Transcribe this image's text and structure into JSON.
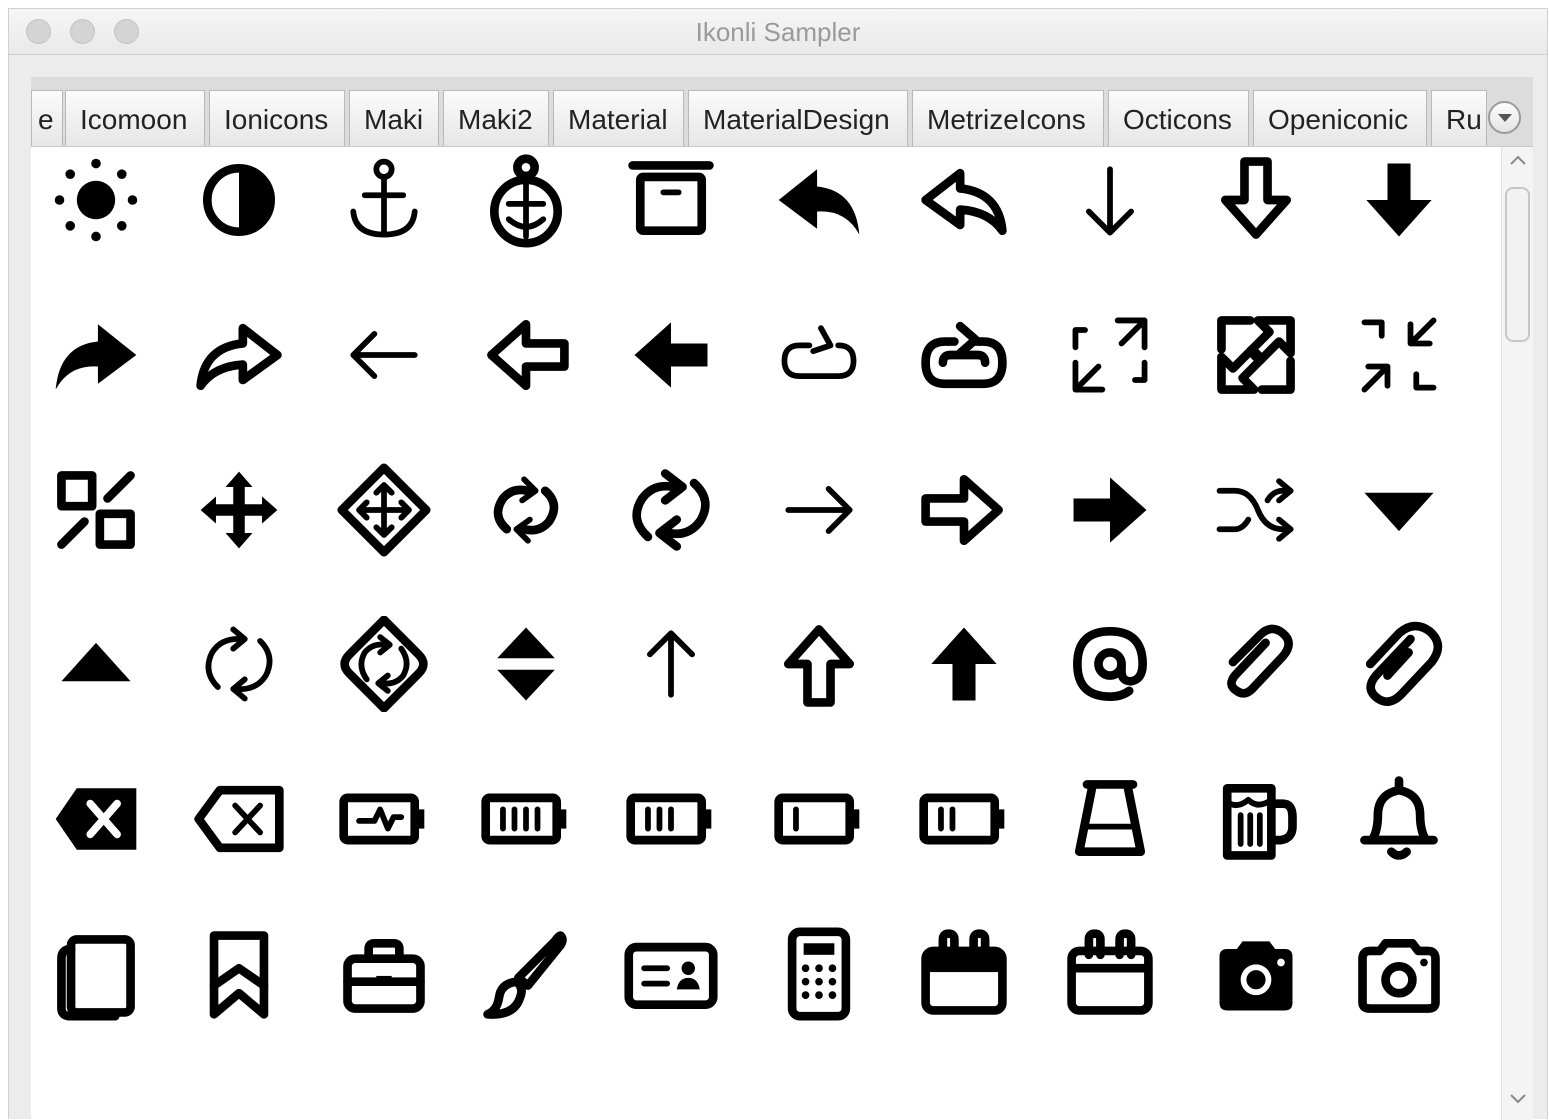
{
  "window": {
    "title": "Ikonli Sampler"
  },
  "tabs": [
    {
      "label": "e"
    },
    {
      "label": "Icomoon"
    },
    {
      "label": "Ionicons"
    },
    {
      "label": "Maki"
    },
    {
      "label": "Maki2"
    },
    {
      "label": "Material"
    },
    {
      "label": "MaterialDesign"
    },
    {
      "label": "MetrizeIcons"
    },
    {
      "label": "Octicons"
    },
    {
      "label": "Openiconic"
    },
    {
      "label": "Ru"
    }
  ],
  "icon_rows": [
    [
      "brightness-icon",
      "contrast-icon",
      "anchor-icon",
      "anchor-circle-icon",
      "archive-icon",
      "reply-filled-icon",
      "reply-outline-icon",
      "arrow-down-thin-icon",
      "arrow-down-outline-icon",
      "arrow-down-filled-icon"
    ],
    [
      "forward-filled-icon",
      "forward-outline-icon",
      "arrow-left-thin-icon",
      "arrow-left-outline-icon",
      "arrow-left-filled-icon",
      "loop-icon",
      "loop-outline-icon",
      "expand-icon",
      "expand-outline-icon",
      "minimize-icon"
    ],
    [
      "minimize-outline-icon",
      "move-icon",
      "move-outline-icon",
      "repeat-icon",
      "repeat-outline-icon",
      "arrow-right-thin-icon",
      "arrow-right-outline-icon",
      "arrow-right-filled-icon",
      "shuffle-icon",
      "caret-down-icon"
    ],
    [
      "caret-up-icon",
      "sync-icon",
      "sync-outline-icon",
      "unsorted-icon",
      "arrow-up-thin-icon",
      "arrow-up-outline-icon",
      "arrow-up-filled-icon",
      "at-icon",
      "attachment-icon",
      "attachment-outline-icon"
    ],
    [
      "backspace-filled-icon",
      "backspace-outline-icon",
      "battery-charge-icon",
      "battery-full-icon",
      "battery-high-icon",
      "battery-low-icon",
      "battery-mid-icon",
      "beaker-icon",
      "beer-icon",
      "bell-icon"
    ],
    [
      "book-icon",
      "bookmark-icon",
      "briefcase-icon",
      "brush-icon",
      "business-card-icon",
      "calculator-icon",
      "calendar-icon",
      "calendar-outline-icon",
      "camera-filled-icon",
      "camera-outline-icon"
    ]
  ]
}
